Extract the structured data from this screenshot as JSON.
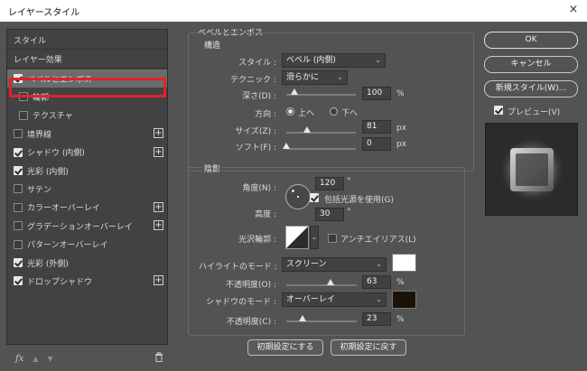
{
  "window": {
    "title": "レイヤースタイル",
    "close_icon": "×"
  },
  "left": {
    "header_style": "スタイル",
    "header_effects": "レイヤー効果",
    "items": [
      {
        "label": "ベベルとエンボス",
        "checked": true,
        "selected": true
      },
      {
        "label": "輪郭",
        "checked": false,
        "sub": true
      },
      {
        "label": "テクスチャ",
        "checked": false,
        "sub": true
      },
      {
        "label": "境界線",
        "checked": false,
        "plus": true
      },
      {
        "label": "シャドウ (内側)",
        "checked": true,
        "plus": true
      },
      {
        "label": "光彩 (内側)",
        "checked": true
      },
      {
        "label": "サテン",
        "checked": false
      },
      {
        "label": "カラーオーバーレイ",
        "checked": false,
        "plus": true
      },
      {
        "label": "グラデーションオーバーレイ",
        "checked": false,
        "plus": true
      },
      {
        "label": "パターンオーバーレイ",
        "checked": false
      },
      {
        "label": "光彩 (外側)",
        "checked": true
      },
      {
        "label": "ドロップシャドウ",
        "checked": true,
        "plus": true
      }
    ],
    "footer": {
      "fx_label": "fx",
      "up_icon": "▲",
      "down_icon": "▼",
      "trash_icon": "🗑"
    }
  },
  "bevel": {
    "group_title": "ベベルとエンボス",
    "structure_title": "構造",
    "style_label": "スタイル :",
    "style_value": "ベベル (内側)",
    "technique_label": "テクニック :",
    "technique_value": "滑らかに",
    "depth_label": "深さ(D) :",
    "depth_value": "100",
    "depth_unit": "%",
    "depth_pct": 0.12,
    "direction_label": "方向 :",
    "direction_up": "上へ",
    "direction_down": "下へ",
    "size_label": "サイズ(Z) :",
    "size_value": "81",
    "size_unit": "px",
    "size_pct": 0.3,
    "soften_label": "ソフト(F) :",
    "soften_value": "0",
    "soften_unit": "px",
    "soften_pct": 0.0
  },
  "shading": {
    "group_title": "陰影",
    "angle_label": "角度(N) :",
    "angle_value": "120",
    "angle_unit": "°",
    "global_light_label": "包括光源を使用(G)",
    "global_light_checked": true,
    "altitude_label": "高度 :",
    "altitude_value": "30",
    "altitude_unit": "°",
    "gloss_label": "光沢輪郭 :",
    "antialias_label": "アンチエイリアス(L)",
    "antialias_checked": false,
    "highlight_mode_label": "ハイライトのモード :",
    "highlight_mode_value": "スクリーン",
    "highlight_color": "#ffffff",
    "highlight_opacity_label": "不透明度(O) :",
    "highlight_opacity_value": "63",
    "highlight_opacity_unit": "%",
    "highlight_opacity_pct": 0.63,
    "shadow_mode_label": "シャドウのモード :",
    "shadow_mode_value": "オーバーレイ",
    "shadow_color": "#1b1306",
    "shadow_opacity_label": "不透明度(C) :",
    "shadow_opacity_value": "23",
    "shadow_opacity_unit": "%",
    "shadow_opacity_pct": 0.23
  },
  "bottom_buttons": {
    "make_default": "初期設定にする",
    "reset_default": "初期設定に戻す"
  },
  "right": {
    "ok": "OK",
    "cancel": "キャンセル",
    "new_style": "新規スタイル(W)...",
    "preview_label": "プレビュー(V)",
    "preview_checked": true
  }
}
